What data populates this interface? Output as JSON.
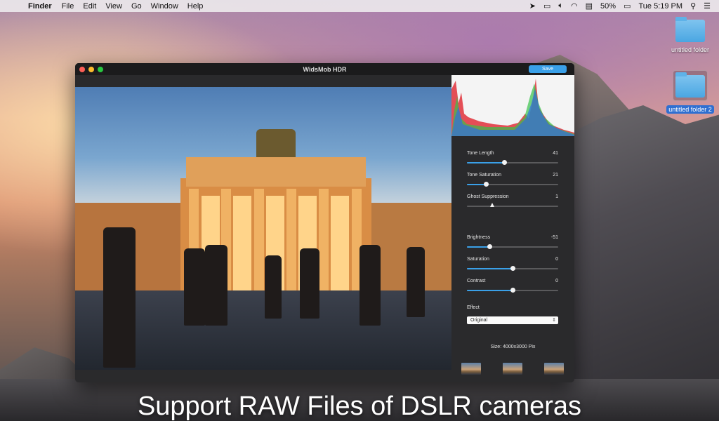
{
  "menubar": {
    "app_name": "Finder",
    "menus": [
      "File",
      "Edit",
      "View",
      "Go",
      "Window",
      "Help"
    ],
    "battery_percent": "50%",
    "clock": "Tue 5:19 PM"
  },
  "desktop": {
    "folders": [
      {
        "label": "untitled folder"
      },
      {
        "label": "untitled folder 2"
      }
    ]
  },
  "window": {
    "title": "WidsMob HDR",
    "save_label": "Save"
  },
  "panel": {
    "sliders": [
      {
        "label": "Tone Length",
        "value": "41",
        "level": 0.41
      },
      {
        "label": "Tone Saturation",
        "value": "21",
        "level": 0.21
      },
      {
        "label": "Ghost Suppression",
        "value": "1",
        "level": 0.28
      },
      {
        "label": "Brightness",
        "value": "-51",
        "level": 0.25
      },
      {
        "label": "Saturation",
        "value": "0",
        "level": 0.5
      },
      {
        "label": "Contrast",
        "value": "0",
        "level": 0.5
      }
    ],
    "effect_label": "Effect",
    "effect_value": "Original",
    "size_text": "Size: 4000x3000 Pix"
  },
  "caption": "Support RAW Files of DSLR cameras",
  "colors": {
    "accent": "#3aa0e8",
    "selection": "#2f6fd1"
  }
}
